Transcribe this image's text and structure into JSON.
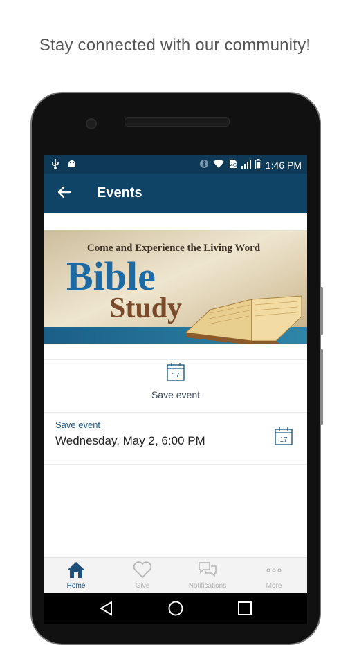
{
  "tagline": "Stay connected with our community!",
  "status_bar": {
    "time": "1:46 PM",
    "left_icons": [
      "usb-icon",
      "android-icon"
    ],
    "right_icons": [
      "bluetooth-icon",
      "wifi-icon",
      "data-icon",
      "signal-icon",
      "battery-icon"
    ]
  },
  "app_bar": {
    "title": "Events",
    "back_icon": "back-arrow-icon"
  },
  "banner": {
    "headline": "Come and Experience the Living Word",
    "word1": "Bible",
    "word2": "Study"
  },
  "save_action": {
    "label": "Save event",
    "calendar_day": "17"
  },
  "event": {
    "caption": "Save event",
    "datetime": "Wednesday, May 2, 6:00 PM",
    "calendar_day": "17"
  },
  "bottom_nav": {
    "items": [
      {
        "label": "Home",
        "icon": "home-icon",
        "active": true
      },
      {
        "label": "Give",
        "icon": "heart-icon",
        "active": false
      },
      {
        "label": "Notifications",
        "icon": "chat-icon",
        "active": false
      },
      {
        "label": "More",
        "icon": "more-icon",
        "active": false
      }
    ]
  },
  "colors": {
    "status_bar": "#0e3a57",
    "app_bar": "#0f4467",
    "accent": "#1d5a85",
    "nav_active": "#1f4f78",
    "nav_inactive": "#b5b5b5"
  }
}
